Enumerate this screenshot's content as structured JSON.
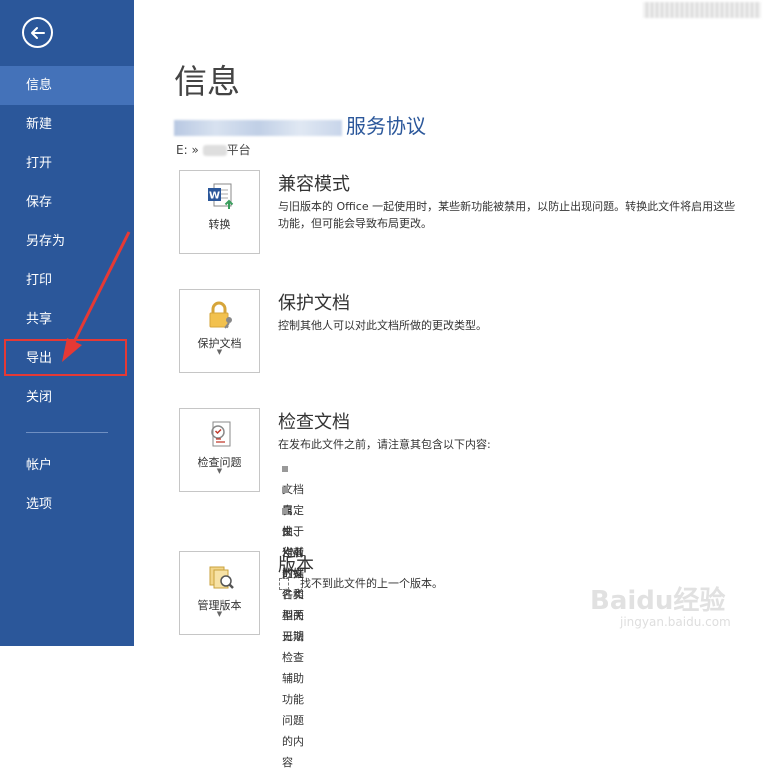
{
  "sidebar": {
    "items": [
      {
        "label": "信息",
        "active": true
      },
      {
        "label": "新建"
      },
      {
        "label": "打开"
      },
      {
        "label": "保存"
      },
      {
        "label": "另存为"
      },
      {
        "label": "打印"
      },
      {
        "label": "共享"
      },
      {
        "label": "导出"
      },
      {
        "label": "关闭"
      }
    ],
    "bottom_items": [
      {
        "label": "帐户"
      },
      {
        "label": "选项"
      }
    ]
  },
  "main": {
    "title": "信息",
    "doc_title": "服务协议",
    "doc_path_prefix": "E: »",
    "doc_path_suffix": "平台",
    "sections": [
      {
        "tile_label": "转换",
        "heading": "兼容模式",
        "description": "与旧版本的 Office 一起使用时，某些新功能被禁用，以防止出现问题。转换此文件将启用这些功能，但可能会导致布局更改。"
      },
      {
        "tile_label": "保护文档",
        "heading": "保护文档",
        "description": "控制其他人可以对此文档所做的更改类型。"
      },
      {
        "tile_label": "检查问题",
        "heading": "检查文档",
        "description": "在发布此文件之前，请注意其包含以下内容:",
        "bullets": [
          "文档属性、作者的姓名和相关日期",
          "自定义 XML 数据",
          "由于当前的文件类型而无法检查辅助功能问题的内容"
        ]
      },
      {
        "tile_label": "管理版本",
        "heading": "版本",
        "description": "找不到此文件的上一个版本。"
      }
    ]
  },
  "watermark": {
    "text": "Baidu经验",
    "sub": "jingyan.baidu.com"
  },
  "colors": {
    "sidebar_bg": "#2b579a",
    "sidebar_active": "#4472b9",
    "accent": "#2b579a",
    "annotation": "#e53935"
  }
}
